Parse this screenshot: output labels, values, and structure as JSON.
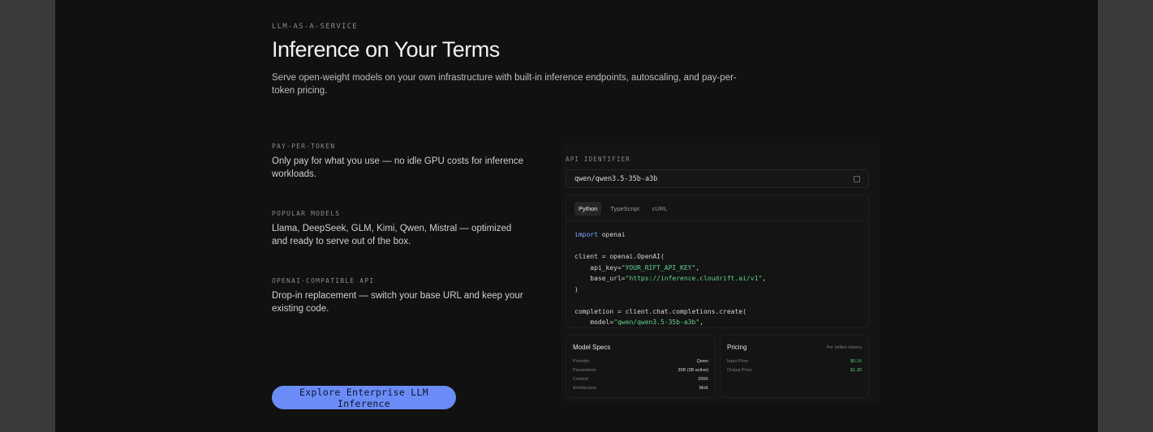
{
  "hero": {
    "eyebrow": "LLM-AS-A-SERVICE",
    "title": "Inference on Your Terms",
    "subtitle": "Serve open-weight models on your own infrastructure with built-in inference endpoints, autoscaling, and pay-per-token pricing."
  },
  "features": [
    {
      "label": "PAY-PER-TOKEN",
      "desc": "Only pay for what you use — no idle GPU costs for inference workloads."
    },
    {
      "label": "POPULAR MODELS",
      "desc": "Llama, DeepSeek, GLM, Kimi, Qwen, Mistral — optimized and ready to serve out of the box."
    },
    {
      "label": "OPENAI-COMPATIBLE API",
      "desc": "Drop-in replacement — switch your base URL and keep your existing code."
    }
  ],
  "cta": {
    "label": "Explore Enterprise LLM Inference"
  },
  "api": {
    "label": "API IDENTIFIER",
    "identifier": "qwen/qwen3.5-35b-a3b"
  },
  "code": {
    "tabs": [
      "Python",
      "TypeScript",
      "cURL"
    ],
    "active_tab": "Python",
    "lines": {
      "l1_kw": "import",
      "l1_rest": " openai",
      "l2": "client = openai.OpenAI(",
      "l3_pre": "    api_key=",
      "l3_str": "\"YOUR_RIFT_API_KEY\"",
      "l3_post": ",",
      "l4_pre": "    base_url=",
      "l4_str": "\"https://inference.cloudrift.ai/v1\"",
      "l5": ")",
      "l6": "completion = client.chat.completions.create(",
      "l7_pre": "    model=",
      "l7_str": "\"qwen/qwen3.5-35b-a3b\"",
      "l7_post": ","
    }
  },
  "model_specs": {
    "title": "Model Specs",
    "rows": [
      {
        "k": "Provider",
        "v": "Qwen"
      },
      {
        "k": "Parameters",
        "v": "35B (3B active)"
      },
      {
        "k": "Context",
        "v": "256K"
      },
      {
        "k": "Architecture",
        "v": "MoE"
      }
    ]
  },
  "pricing": {
    "title": "Pricing",
    "note": "Per million tokens",
    "rows": [
      {
        "k": "Input Price",
        "v": "$0.16"
      },
      {
        "k": "Output Price",
        "v": "$1.30"
      }
    ],
    "accent": "#4fd27f"
  },
  "colors": {
    "accent": "#6b8cf7",
    "background": "#111111"
  }
}
